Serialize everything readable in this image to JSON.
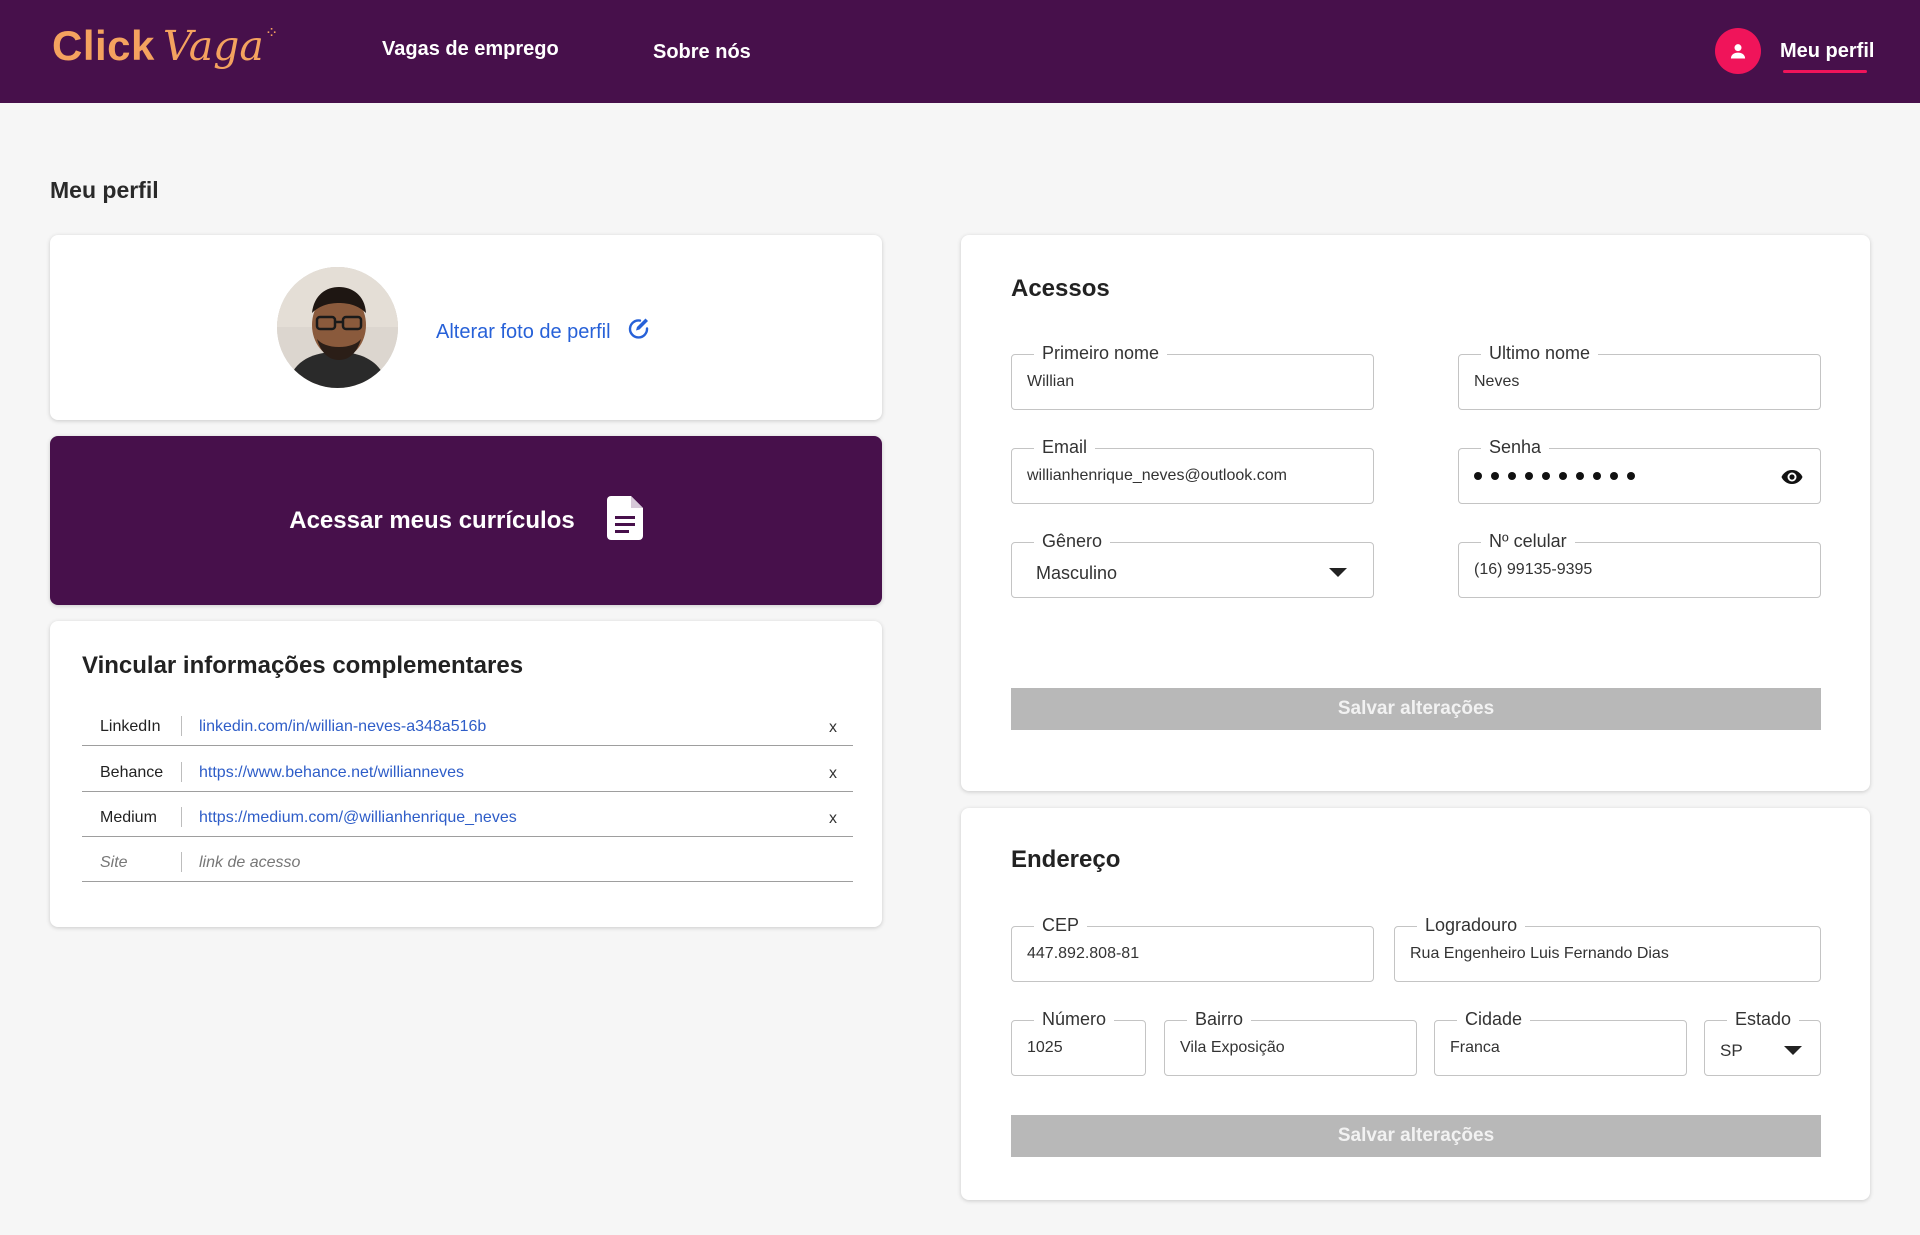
{
  "header": {
    "logo_click": "Click",
    "logo_vaga": "Vaga",
    "nav": [
      "Vagas de emprego",
      "Sobre nós"
    ],
    "profile_label": "Meu perfil",
    "avatar_icon": "person-icon",
    "bg_color": "#47104b",
    "accent_color": "#f0145a"
  },
  "page_title": "Meu perfil",
  "photo_card": {
    "change_photo_label": "Alterar foto de perfil",
    "edit_icon": "edit-circle-icon"
  },
  "curriculos": {
    "label": "Acessar meus currículos",
    "icon": "document-icon"
  },
  "links": {
    "title": "Vincular informações complementares",
    "rows": [
      {
        "label": "LinkedIn",
        "value": "linkedin.com/in/willian-neves-a348a516b",
        "remove": "x"
      },
      {
        "label": "Behance",
        "value": "https://www.behance.net/willianneves",
        "remove": "x"
      },
      {
        "label": "Medium",
        "value": "https://medium.com/@willianhenrique_neves",
        "remove": "x"
      }
    ],
    "new_row": {
      "label": "Site",
      "placeholder": "link de acesso"
    }
  },
  "acessos": {
    "title": "Acessos",
    "first_name": {
      "label": "Primeiro nome",
      "value": "Willian"
    },
    "last_name": {
      "label": "Ultimo nome",
      "value": "Neves"
    },
    "email": {
      "label": "Email",
      "value": "willianhenrique_neves@outlook.com"
    },
    "password": {
      "label": "Senha",
      "masked_length": 10,
      "eye_icon": "eye-icon"
    },
    "gender": {
      "label": "Gênero",
      "value": "Masculino"
    },
    "phone": {
      "label": "Nº celular",
      "value": "(16) 99135-9395"
    },
    "save_label": "Salvar alterações"
  },
  "endereco": {
    "title": "Endereço",
    "cep": {
      "label": "CEP",
      "value": "447.892.808-81"
    },
    "logradouro": {
      "label": "Logradouro",
      "value": "Rua Engenheiro Luis Fernando Dias"
    },
    "numero": {
      "label": "Número",
      "value": "1025"
    },
    "bairro": {
      "label": "Bairro",
      "value": "Vila Exposição"
    },
    "cidade": {
      "label": "Cidade",
      "value": "Franca"
    },
    "estado": {
      "label": "Estado",
      "value": "SP"
    },
    "save_label": "Salvar alterações"
  }
}
